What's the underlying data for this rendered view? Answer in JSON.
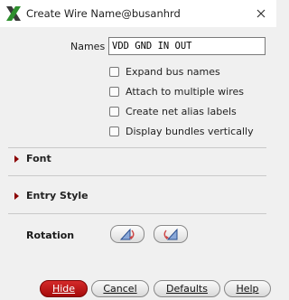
{
  "window": {
    "title": "Create Wire Name@busanhrd",
    "icon": "x-logo-icon",
    "close_icon": "close-icon"
  },
  "names": {
    "label": "Names",
    "value": "VDD GND IN OUT"
  },
  "options": [
    {
      "label": "Expand bus names",
      "checked": false
    },
    {
      "label": "Attach to multiple wires",
      "checked": false
    },
    {
      "label": "Create net alias labels",
      "checked": false
    },
    {
      "label": "Display bundles vertically",
      "checked": false
    }
  ],
  "sections": {
    "font": "Font",
    "entry_style": "Entry Style",
    "rotation": "Rotation"
  },
  "buttons": {
    "hide": "Hide",
    "cancel": "Cancel",
    "defaults": "Defaults",
    "help": "Help"
  },
  "colors": {
    "accent": "#b01515",
    "section_arrow": "#8b0000"
  }
}
